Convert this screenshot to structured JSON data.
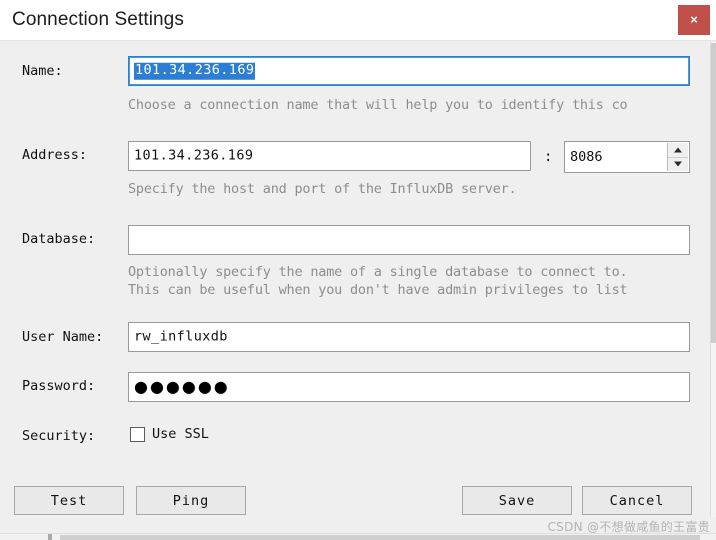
{
  "window": {
    "title": "Connection Settings",
    "close_label": "×",
    "close_icon": "close-icon",
    "titlebar_bg": "#ffffff",
    "close_bg": "#c0504a",
    "body_bg": "#efefef"
  },
  "form": {
    "name": {
      "label": "Name:",
      "value": "101.34.236.169",
      "placeholder": "",
      "hint": "Choose a connection name that will help you to identify this co",
      "focused": true,
      "selection_color": "#2a7fd4",
      "focus_border_color": "#2f7fd0"
    },
    "address": {
      "label": "Address:",
      "value": "101.34.236.169",
      "placeholder": "",
      "separator": ":",
      "port": "8086",
      "hint": "Specify the host and port of the InfluxDB server."
    },
    "database": {
      "label": "Database:",
      "value": "",
      "placeholder": "",
      "hint_line1": "Optionally specify the name of a single database to connect to.",
      "hint_line2": "This can be useful when you don't have admin privileges to list"
    },
    "username": {
      "label": "User Name:",
      "value": "rw_influxdb",
      "placeholder": ""
    },
    "password": {
      "label": "Password:",
      "value": "●●●●●●",
      "placeholder": ""
    },
    "security": {
      "label": "Security:",
      "checkbox_label": "Use SSL",
      "checked": false
    }
  },
  "buttons": {
    "test": "Test",
    "ping": "Ping",
    "save": "Save",
    "cancel": "Cancel"
  },
  "watermark": {
    "text": "CSDN @不想做咸鱼的王富贵"
  }
}
